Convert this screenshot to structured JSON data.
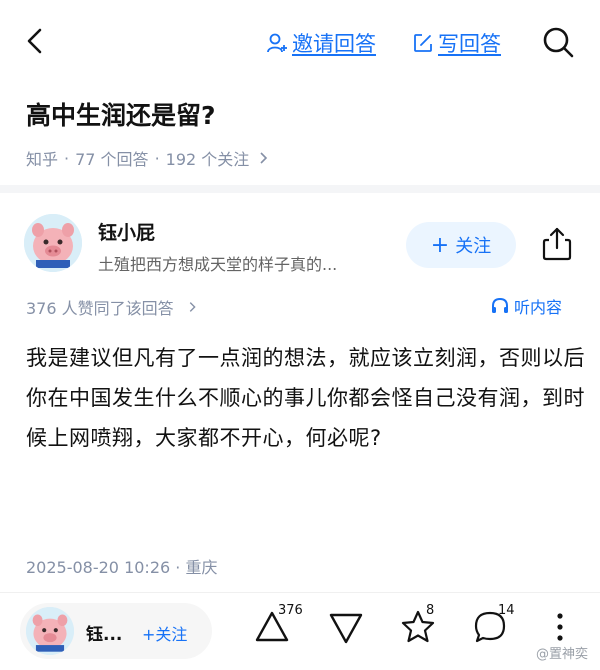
{
  "nav": {
    "back_icon": "chevron-left-icon",
    "invite_label": "邀请回答",
    "write_label": "写回答",
    "search_icon": "search-icon",
    "accent_color": "#1772f6"
  },
  "question": {
    "title": "高中生润还是留?",
    "source": "知乎",
    "answers_count": "77 个回答",
    "followers_count": "192 个关注"
  },
  "author": {
    "name": "钰小屁",
    "bio": "土殖把西方想成天堂的样子真的...",
    "follow_label": "关注",
    "share_icon": "share-icon"
  },
  "answer": {
    "likes_text": "376 人赞同了该回答",
    "listen_label": "听内容",
    "body": "我是建议但凡有了一点润的想法，就应该立刻润，否则以后你在中国发生什么不顺心的事儿你都会怪自己没有润，到时候上网喷翔，大家都不开心，何必呢?",
    "timestamp": "2025-08-20 10:26 · 重庆"
  },
  "bottom_bar": {
    "author_short": "钰...",
    "follow_label": "+关注",
    "upvote_count": "376",
    "favorite_count": "8",
    "comment_count": "14",
    "watermark": "@置神奕"
  }
}
